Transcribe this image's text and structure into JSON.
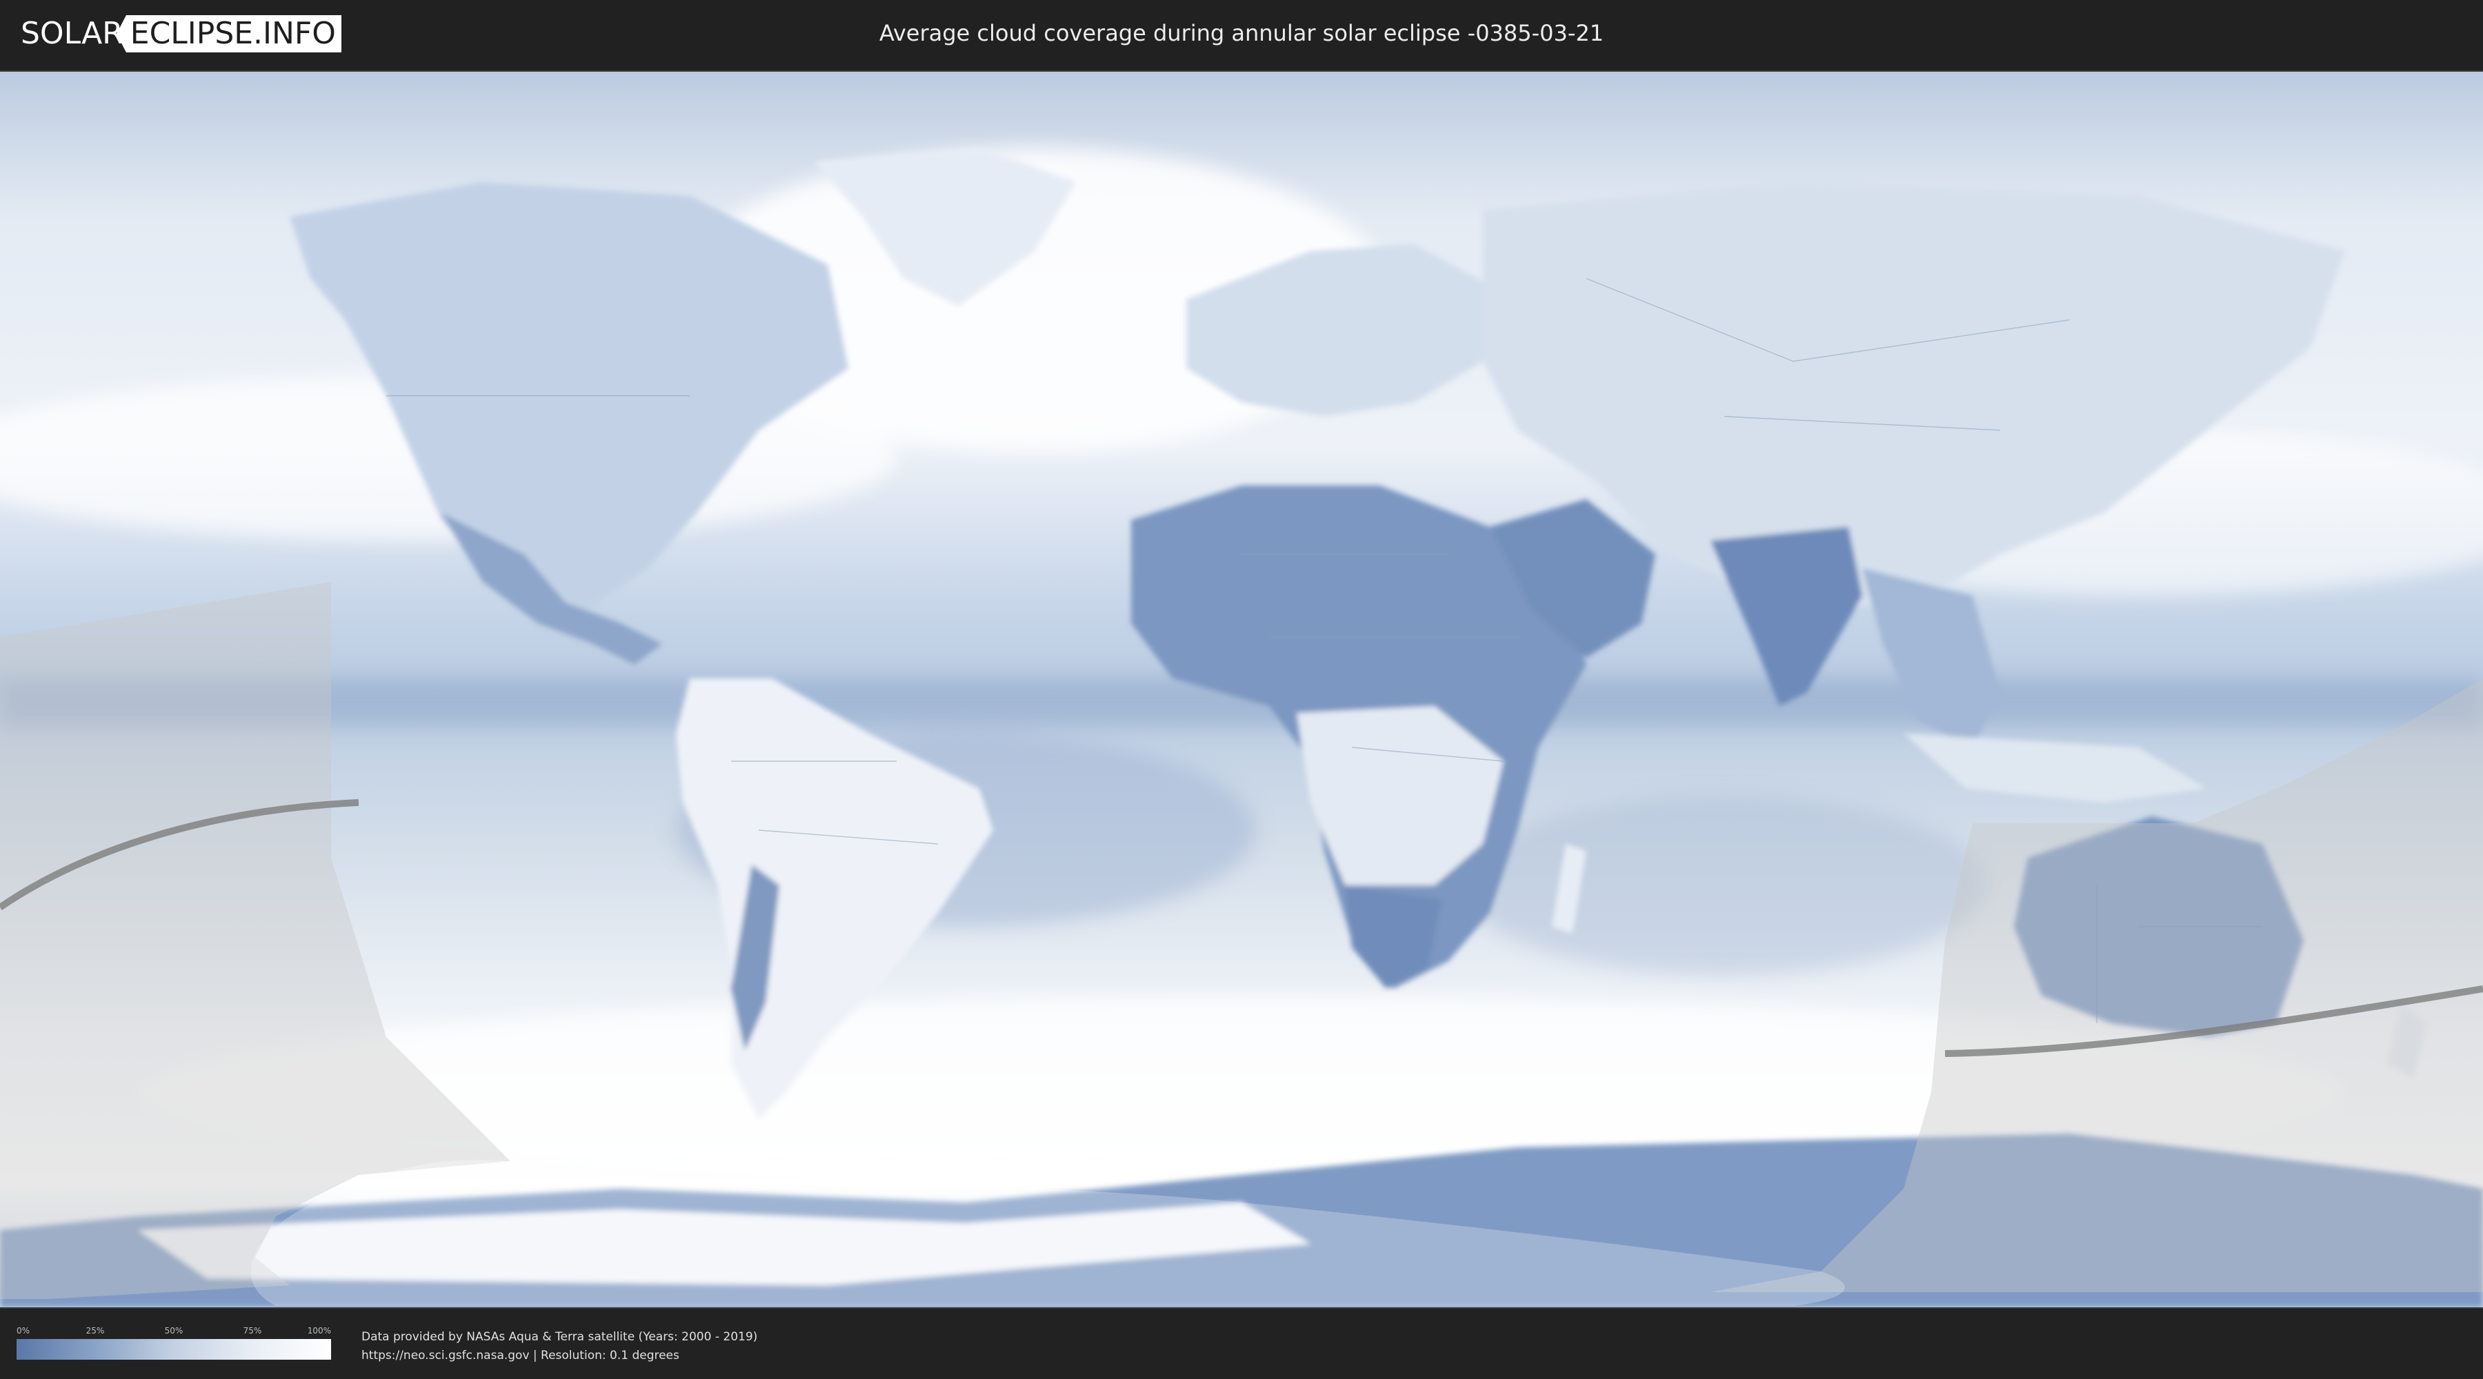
{
  "header": {
    "logo_left": "SOLAR",
    "logo_right": "ECLIPSE.INFO",
    "title": "Average cloud coverage during annular solar eclipse -0385-03-21"
  },
  "legend": {
    "ticks": [
      "0%",
      "25%",
      "50%",
      "75%",
      "100%"
    ],
    "scale_colors": [
      "#5a77a8",
      "#8aa3c7",
      "#c4d1e3",
      "#e9eef6",
      "#ffffff"
    ]
  },
  "footer": {
    "credit_line": "Data provided by NASAs Aqua & Terra satellite (Years: 2000 - 2019)",
    "source_line": "https://neo.sci.gsfc.nasa.gov | Resolution: 0.1 degrees"
  },
  "map": {
    "colors": {
      "ocean_cloud": "#d9e3ef",
      "clear_sky": "#5f7cad",
      "cloudy": "#ffffff",
      "shadow_overlay": "#c9c9c9",
      "central_line": "#7d7d7d",
      "border": "#8c9fb8"
    }
  }
}
